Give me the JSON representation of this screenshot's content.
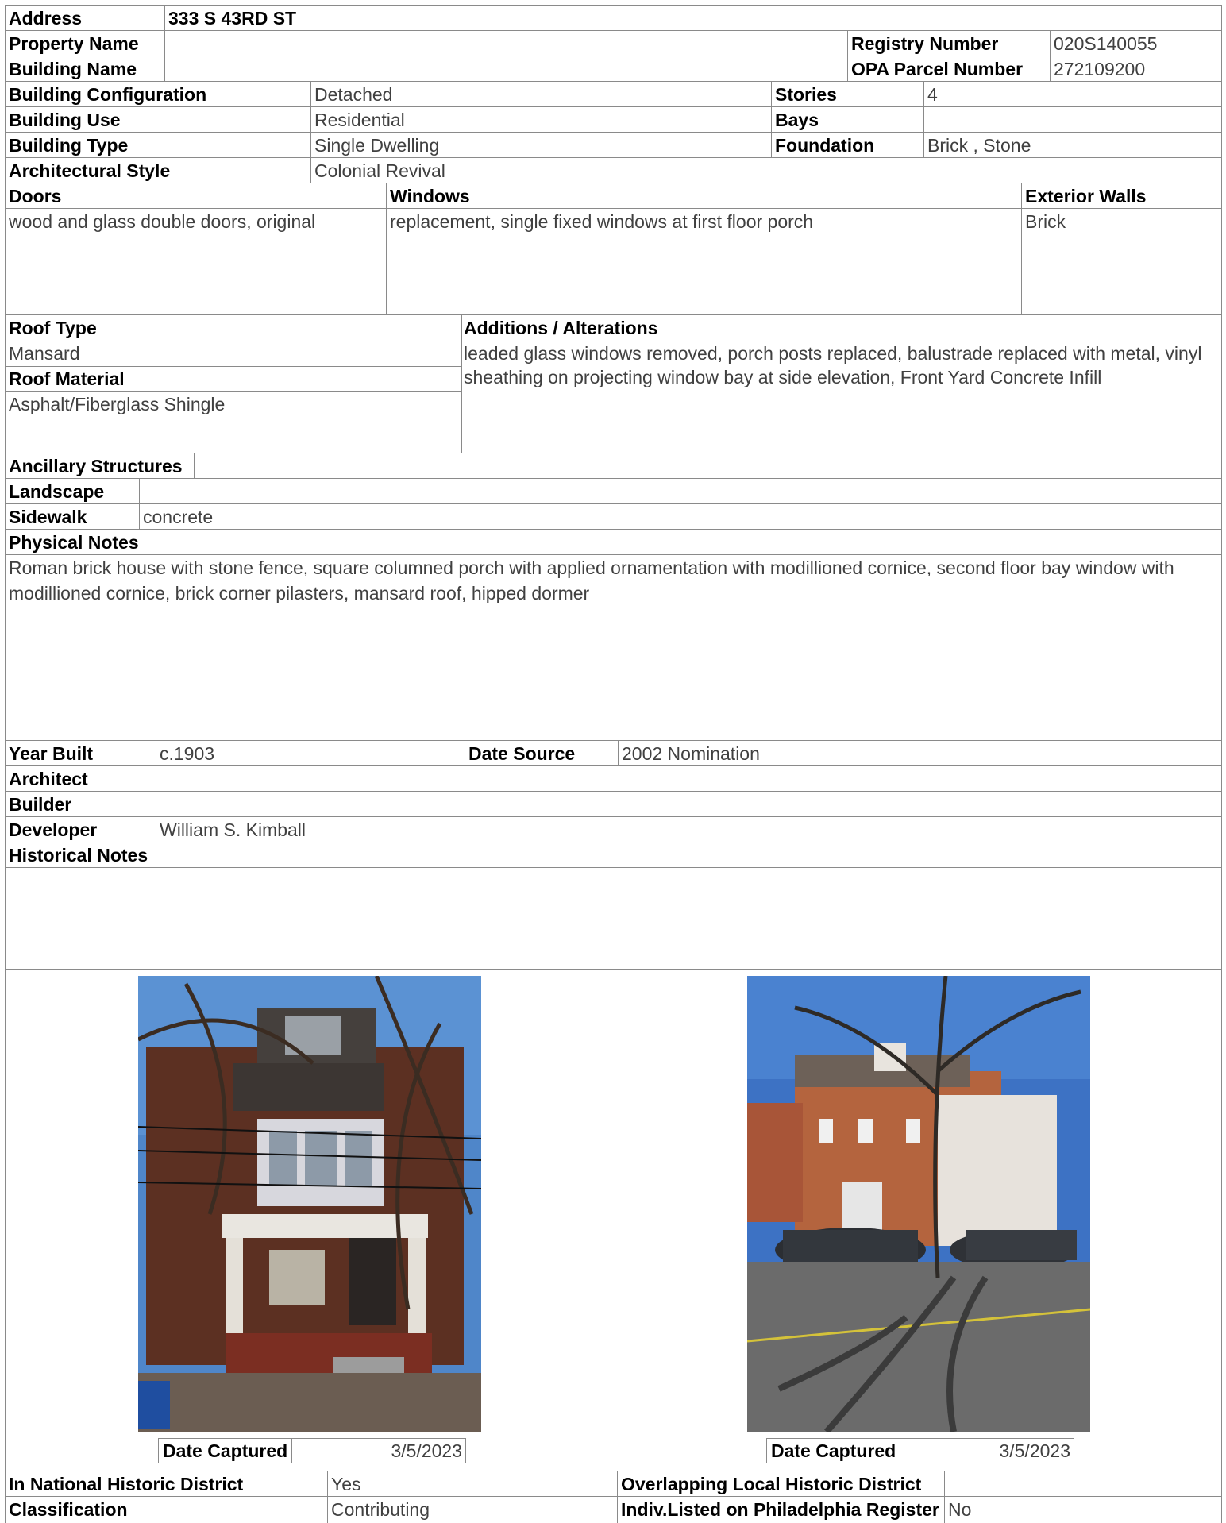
{
  "address": {
    "label": "Address",
    "value": "333 S 43RD ST"
  },
  "property_name": {
    "label": "Property Name",
    "value": ""
  },
  "registry_number": {
    "label": "Registry Number",
    "value": "020S140055"
  },
  "building_name": {
    "label": "Building Name",
    "value": ""
  },
  "opa_parcel": {
    "label": "OPA Parcel Number",
    "value": "272109200"
  },
  "building_configuration": {
    "label": "Building Configuration",
    "value": "Detached"
  },
  "stories": {
    "label": "Stories",
    "value": "4"
  },
  "building_use": {
    "label": "Building Use",
    "value": "Residential"
  },
  "bays": {
    "label": "Bays",
    "value": ""
  },
  "building_type": {
    "label": "Building Type",
    "value": "Single Dwelling"
  },
  "foundation": {
    "label": "Foundation",
    "value": "Brick , Stone"
  },
  "architectural_style": {
    "label": "Architectural Style",
    "value": "Colonial Revival"
  },
  "doors": {
    "label": "Doors",
    "value": "wood and glass double doors, original"
  },
  "windows": {
    "label": "Windows",
    "value": "replacement, single fixed windows at first floor porch"
  },
  "exterior_walls": {
    "label": "Exterior Walls",
    "value": "Brick"
  },
  "roof_type": {
    "label": "Roof Type",
    "value": "Mansard"
  },
  "roof_material": {
    "label": "Roof Material",
    "value": "Asphalt/Fiberglass Shingle"
  },
  "additions": {
    "label": "Additions / Alterations",
    "value": "leaded glass windows removed, porch posts replaced, balustrade replaced with metal, vinyl sheathing on projecting window bay at side elevation, Front Yard Concrete Infill"
  },
  "ancillary": {
    "label": "Ancillary Structures",
    "value": ""
  },
  "landscape": {
    "label": "Landscape",
    "value": ""
  },
  "sidewalk": {
    "label": "Sidewalk",
    "value": "concrete"
  },
  "physical_notes": {
    "label": "Physical Notes",
    "value": "Roman brick house with stone fence, square columned porch with applied ornamentation with modillioned cornice, second floor bay window with modillioned cornice, brick corner pilasters, mansard roof, hipped dormer"
  },
  "year_built": {
    "label": "Year Built",
    "value": "c.1903"
  },
  "date_source": {
    "label": "Date Source",
    "value": "2002 Nomination"
  },
  "architect": {
    "label": "Architect",
    "value": ""
  },
  "builder": {
    "label": "Builder",
    "value": ""
  },
  "developer": {
    "label": "Developer",
    "value": "William S. Kimball"
  },
  "historical_notes": {
    "label": "Historical Notes",
    "value": ""
  },
  "photos": [
    {
      "caption_label": "Date Captured",
      "date": "3/5/2023"
    },
    {
      "caption_label": "Date Captured",
      "date": "3/5/2023"
    }
  ],
  "national_district": {
    "label": "In National Historic District",
    "value": "Yes"
  },
  "local_district": {
    "label": "Overlapping Local Historic District",
    "value": ""
  },
  "classification": {
    "label": "Classification",
    "value": "Contributing"
  },
  "indiv_listed": {
    "label": "Indiv.Listed on Philadelphia Register",
    "value": "No"
  }
}
